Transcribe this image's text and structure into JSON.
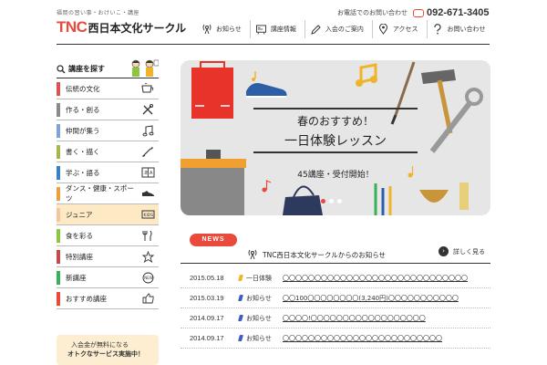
{
  "header": {
    "tagline": "福岡の習い事・おけいこ・講座",
    "logo_tnc": "TNC",
    "logo_name": "西日本文化サークル",
    "phone_label": "お電話でのお問い合わせ",
    "phone_number": "092-671-3405"
  },
  "gnav": [
    {
      "label": "お知らせ",
      "icon": "antenna-icon"
    },
    {
      "label": "講座情報",
      "icon": "board-icon"
    },
    {
      "label": "入会のご案内",
      "icon": "pencil-icon"
    },
    {
      "label": "アクセス",
      "icon": "pin-icon"
    },
    {
      "label": "お問い合わせ",
      "icon": "question-icon"
    }
  ],
  "sidebar": {
    "heading": "講座を探す",
    "items": [
      {
        "label": "伝統の文化",
        "color": "#d9534f",
        "icon": "teacup-icon"
      },
      {
        "label": "作る・創る",
        "color": "#8a8a8a",
        "icon": "tools-icon"
      },
      {
        "label": "仲間が集う",
        "color": "#7aa6d6",
        "icon": "music-note-icon"
      },
      {
        "label": "書く・描く",
        "color": "#a1b84a",
        "icon": "brush-icon"
      },
      {
        "label": "学ぶ・語る",
        "color": "#3b7ec9",
        "icon": "book-icon"
      },
      {
        "label": "ダンス・健康・スポーツ",
        "color": "#e7a23c",
        "icon": "shoe-icon"
      },
      {
        "label": "ジュニア",
        "color": "#f3c6a0",
        "icon": "kids-icon"
      },
      {
        "label": "食を彩る",
        "color": "#8cc63f",
        "icon": "cutlery-icon"
      },
      {
        "label": "特別講座",
        "color": "#c44a4a",
        "icon": "star-icon"
      },
      {
        "label": "新講座",
        "color": "#3aaf5a",
        "icon": "new-icon"
      },
      {
        "label": "おすすめ講座",
        "color": "#e94a3b",
        "icon": "like-icon"
      }
    ]
  },
  "promo": {
    "line1": "入会金が無料になる",
    "line2": "オトクなサービス実施中！"
  },
  "hero": {
    "title1": "春のおすすめ！",
    "title2": "一日体験レッスン",
    "subtitle": "45講座・受付開始！",
    "dots": 3,
    "active_dot": 0
  },
  "news": {
    "badge": "NEWS",
    "title": "TNC西日本文化サークルからのお知らせ",
    "more_label": "詳しく見る",
    "rows": [
      {
        "date": "2015.05.18",
        "category": "一日体験",
        "cat_color": "#f0b429",
        "text": "〇〇〇〇〇〇〇〇〇〇〇〇〇〇〇〇〇〇〇〇〇〇〇〇〇〇〇〇〇"
      },
      {
        "date": "2015.03.19",
        "category": "お知らせ",
        "cat_color": "#3b5fc0",
        "text": "〇〇100〇〇〇〇〇〇〇〇(3,240円)〇〇〇〇〇〇〇〇〇〇〇"
      },
      {
        "date": "2014.09.17",
        "category": "お知らせ",
        "cat_color": "#3b5fc0",
        "text": "〇〇〇〇!〇〇〇〇〇〇〇〇〇〇〇〇〇〇〇〇〇〇"
      },
      {
        "date": "2014.09.17",
        "category": "お知らせ",
        "cat_color": "#3b5fc0",
        "text": "〇〇〇〇〇〇〇〇〇〇〇〇〇〇〇〇〇〇〇〇〇〇〇〇〇"
      }
    ]
  }
}
